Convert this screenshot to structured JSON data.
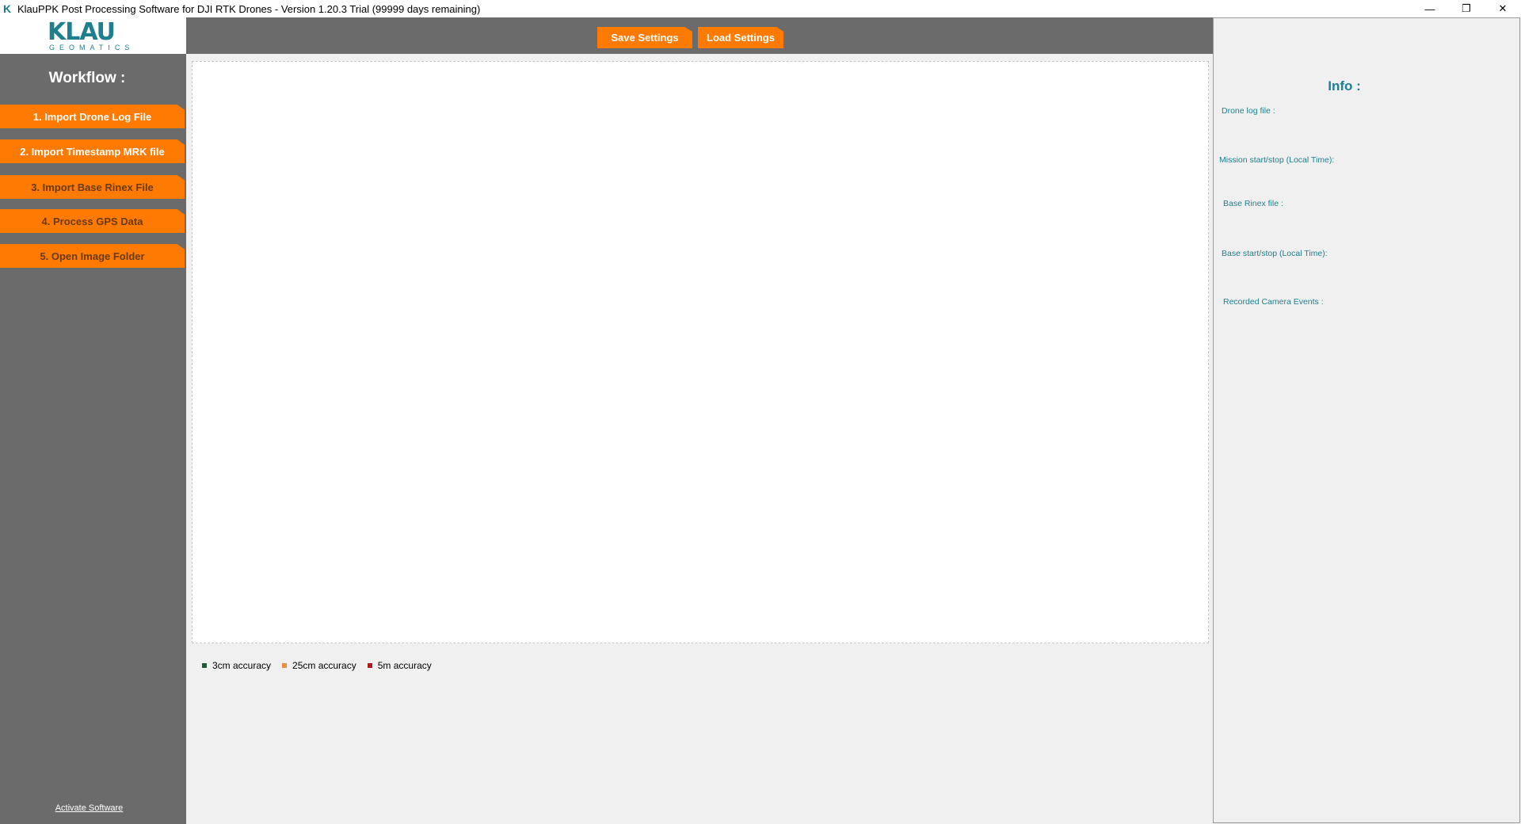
{
  "window": {
    "app_icon": "K",
    "title": "KlauPPK Post Processing Software for DJI RTK Drones - Version 1.20.3 Trial (99999 days remaining)",
    "controls": {
      "minimize": "—",
      "restore": "❐",
      "close": "✕"
    }
  },
  "logo": {
    "main": "KLAU",
    "sub": "GEOMATICS"
  },
  "sidebar": {
    "heading": "Workflow :",
    "steps": [
      {
        "label": "1. Import Drone Log File"
      },
      {
        "label": "2. Import Timestamp MRK file"
      },
      {
        "label": "3. Import Base Rinex File"
      },
      {
        "label": "4. Process GPS Data"
      },
      {
        "label": "5. Open Image Folder"
      }
    ],
    "activate_link": "Activate Software"
  },
  "toolbar": {
    "save_label": "Save Settings",
    "load_label": "Load Settings"
  },
  "legend": [
    {
      "label": "3cm accuracy",
      "color": "#1e5a32"
    },
    {
      "label": "25cm accuracy",
      "color": "#e8913a"
    },
    {
      "label": "5m accuracy",
      "color": "#b01b1b"
    }
  ],
  "info": {
    "title": "Info :",
    "labels": {
      "drone_log": "Drone log file :",
      "mission_time": "Mission start/stop (Local Time):",
      "base_rinex": "Base Rinex file :",
      "base_time": "Base start/stop (Local Time):",
      "camera_events": "Recorded Camera Events :"
    }
  },
  "colors": {
    "accent_orange": "#ff7a00",
    "brand_teal": "#1f7f8c",
    "sidebar_gray": "#6b6b6b"
  }
}
